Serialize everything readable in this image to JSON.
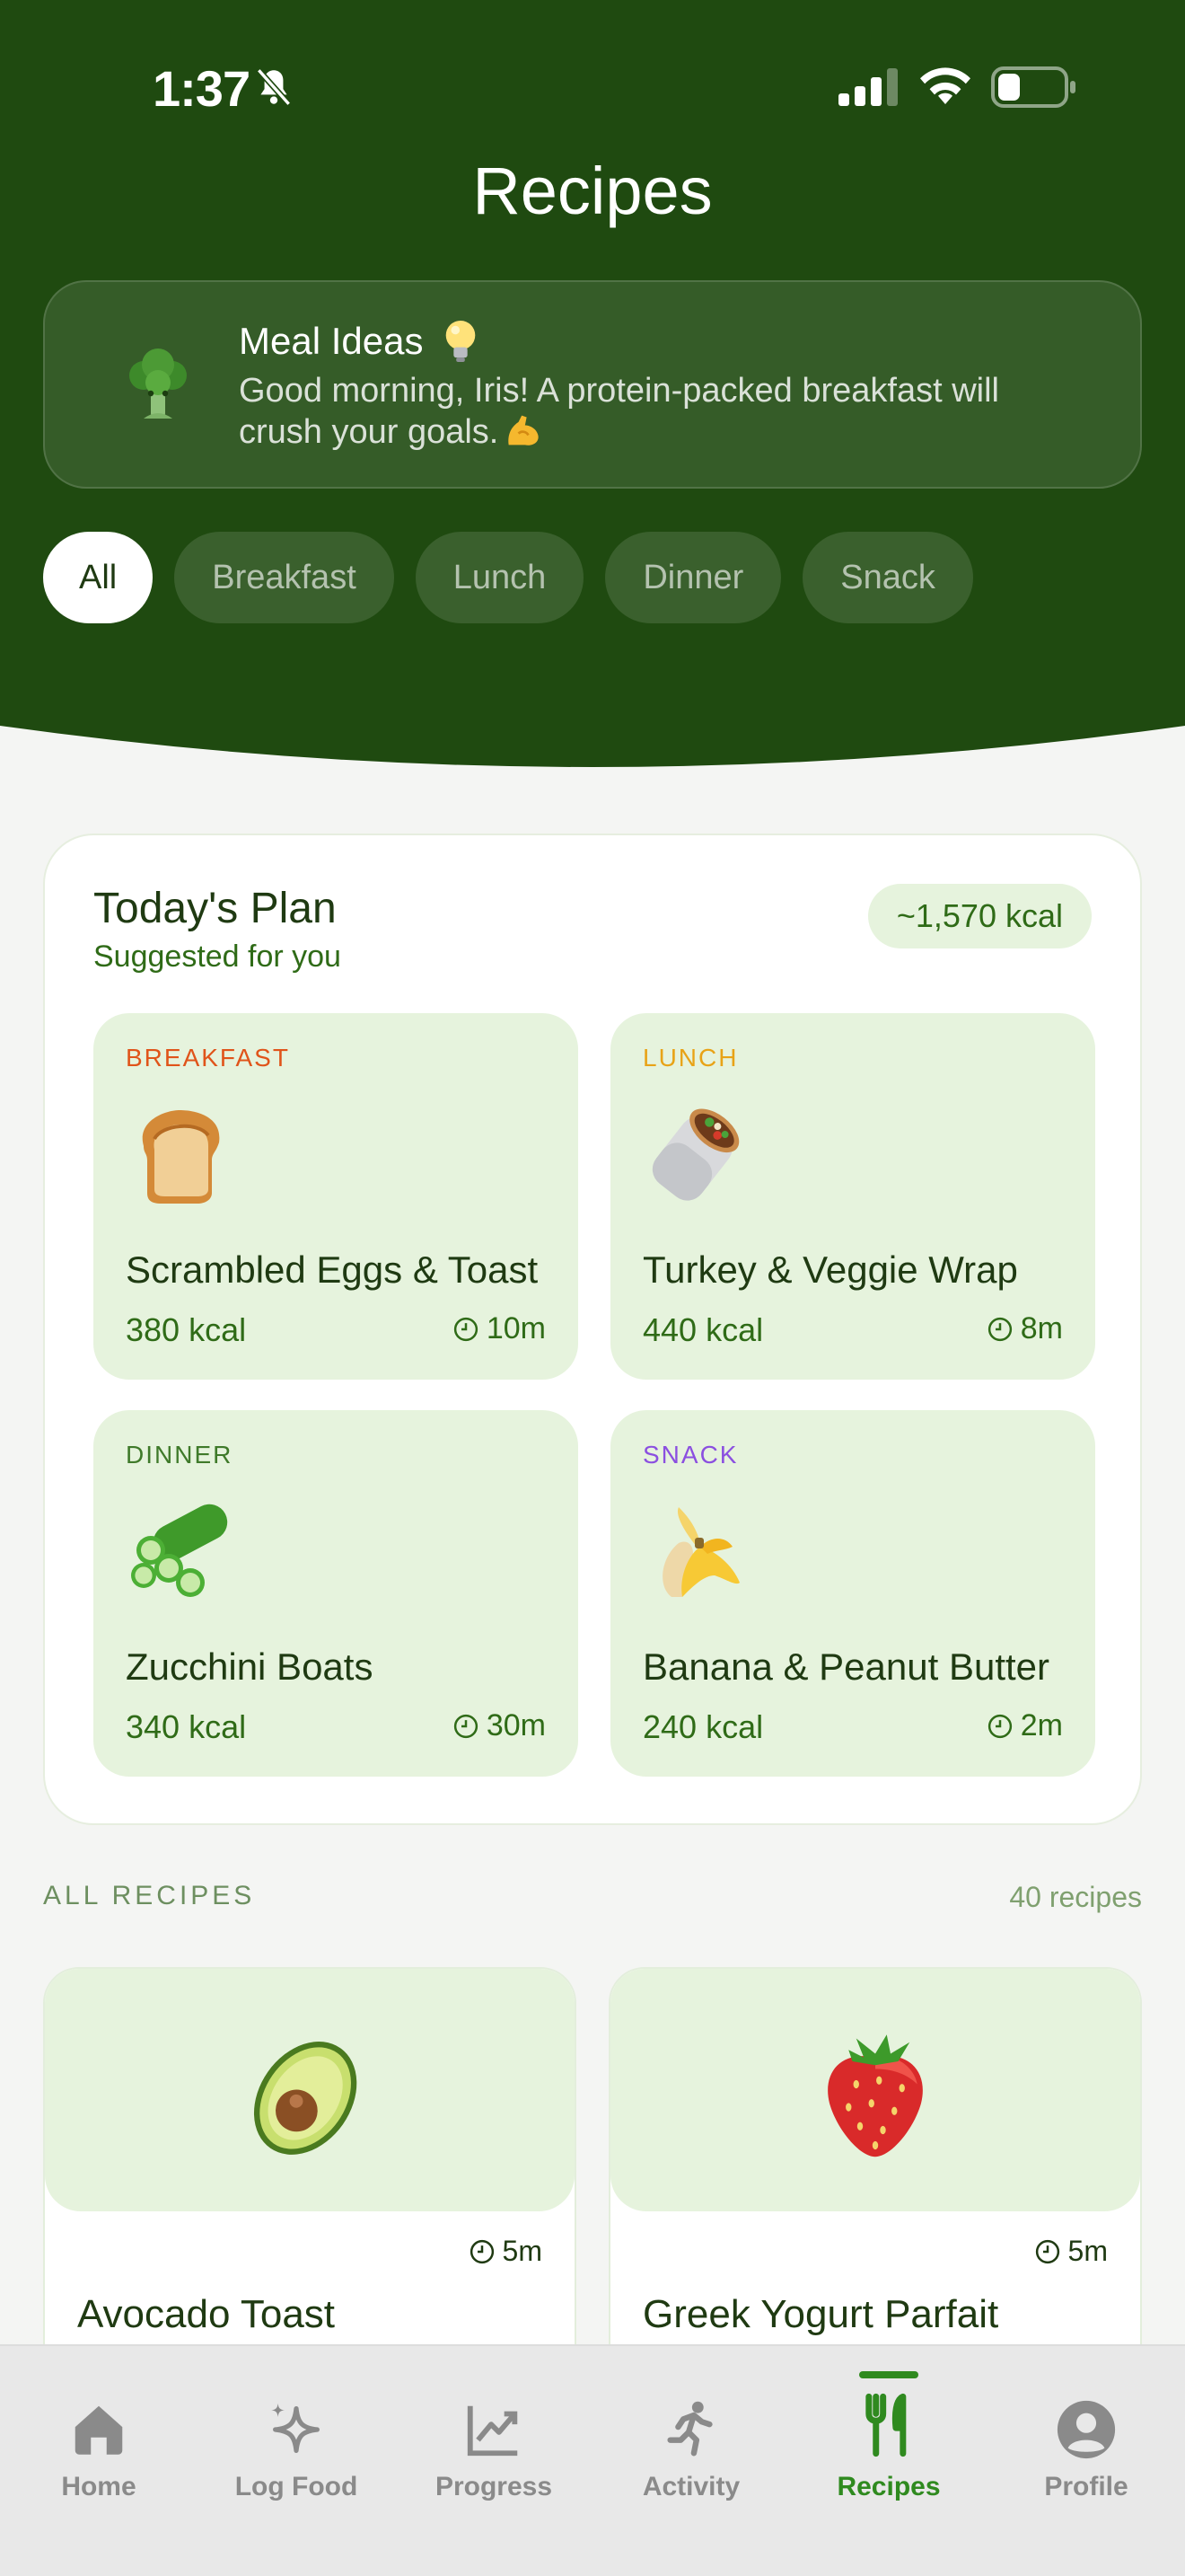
{
  "status_bar": {
    "time": "1:37"
  },
  "header": {
    "title": "Recipes"
  },
  "meal_ideas": {
    "title": "Meal Ideas",
    "message": "Good morning, Iris! A protein-packed breakfast will crush your goals."
  },
  "filters": [
    "All",
    "Breakfast",
    "Lunch",
    "Dinner",
    "Snack"
  ],
  "todays_plan": {
    "title": "Today's Plan",
    "subtitle": "Suggested for you",
    "total_kcal": "~1,570 kcal",
    "meals": [
      {
        "tag": "BREAKFAST",
        "tag_color": "#e0541a",
        "emoji": "bread",
        "name": "Scrambled Eggs & Toast",
        "kcal": "380 kcal",
        "time": "10m"
      },
      {
        "tag": "LUNCH",
        "tag_color": "#e8a317",
        "emoji": "burrito",
        "name": "Turkey & Veggie Wrap",
        "kcal": "440 kcal",
        "time": "8m"
      },
      {
        "tag": "DINNER",
        "tag_color": "#3f7a2a",
        "emoji": "cucumber",
        "name": "Zucchini Boats",
        "kcal": "340 kcal",
        "time": "30m"
      },
      {
        "tag": "SNACK",
        "tag_color": "#8b4fe0",
        "emoji": "banana",
        "name": "Banana & Peanut Butter",
        "kcal": "240 kcal",
        "time": "2m"
      }
    ]
  },
  "all_recipes": {
    "label": "ALL RECIPES",
    "count": "40 recipes",
    "items": [
      {
        "emoji": "avocado",
        "name": "Avocado Toast",
        "time": "5m"
      },
      {
        "emoji": "strawberry",
        "name": "Greek Yogurt Parfait",
        "time": "5m"
      }
    ]
  },
  "bottom_nav": [
    {
      "label": "Home",
      "icon": "home-icon",
      "active": false
    },
    {
      "label": "Log Food",
      "icon": "sparkle-icon",
      "active": false
    },
    {
      "label": "Progress",
      "icon": "chart-icon",
      "active": false
    },
    {
      "label": "Activity",
      "icon": "runner-icon",
      "active": false
    },
    {
      "label": "Recipes",
      "icon": "fork-knife-icon",
      "active": true
    },
    {
      "label": "Profile",
      "icon": "profile-icon",
      "active": false
    }
  ],
  "colors": {
    "header_green": "#1f4a10",
    "accent_green": "#2f8a1f",
    "tile_green": "#e6f3dd"
  }
}
